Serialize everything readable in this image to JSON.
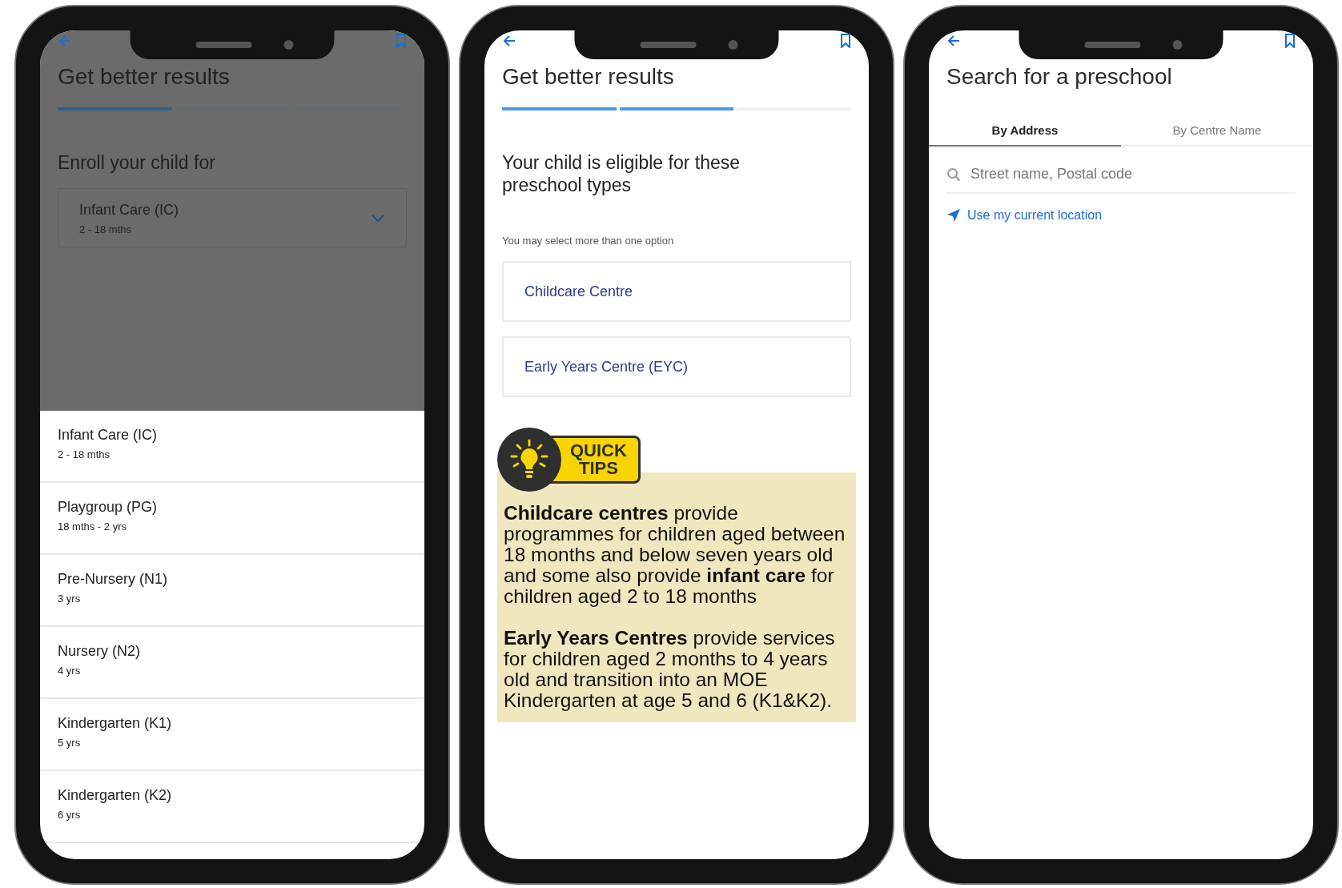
{
  "phones": [
    {
      "kind": "enroll",
      "title": "Get better results",
      "steps": [
        {
          "done": true
        },
        {
          "done": false
        },
        {
          "done": false
        }
      ],
      "heading": "Enroll your child for",
      "dropdown": {
        "label": "Infant Care (IC)",
        "sub": "2 - 18 mths"
      },
      "options": [
        {
          "label": "Infant Care (IC)",
          "sub": "2 - 18 mths"
        },
        {
          "label": "Playgroup (PG)",
          "sub": "18 mths - 2 yrs"
        },
        {
          "label": "Pre-Nursery (N1)",
          "sub": "3 yrs"
        },
        {
          "label": "Nursery (N2)",
          "sub": "4 yrs"
        },
        {
          "label": "Kindergarten (K1)",
          "sub": "5 yrs"
        },
        {
          "label": "Kindergarten (K2)",
          "sub": "6 yrs"
        }
      ]
    },
    {
      "kind": "eligible",
      "title": "Get better results",
      "steps": [
        {
          "done": true
        },
        {
          "done": true
        },
        {
          "done": false
        }
      ],
      "heading": "Your child is eligible for these preschool types",
      "hint": "You may select more than one option",
      "choices": [
        {
          "label": "Childcare Centre",
          "selected": false
        },
        {
          "label": "Early Years Centre (EYC)",
          "selected": false
        }
      ],
      "tips": {
        "badge": [
          "QUICK",
          "TIPS"
        ],
        "paragraphs": [
          "**Childcare centres** provide programmes for children aged between 18 months and below seven years old and some also provide **infant care** for children aged 2 to 18 months",
          "**Early Years Centres** provide services for children aged 2 months to 4 years old and transition into an MOE Kindergarten at age 5 and 6 (K1&K2)."
        ]
      }
    },
    {
      "kind": "search",
      "title": "Search for a preschool",
      "tabs": [
        {
          "label": "By Address",
          "selected": true
        },
        {
          "label": "By Centre Name",
          "selected": false
        }
      ],
      "search": {
        "placeholder": "Street name, Postal code"
      },
      "location_link": "Use my current location"
    }
  ]
}
